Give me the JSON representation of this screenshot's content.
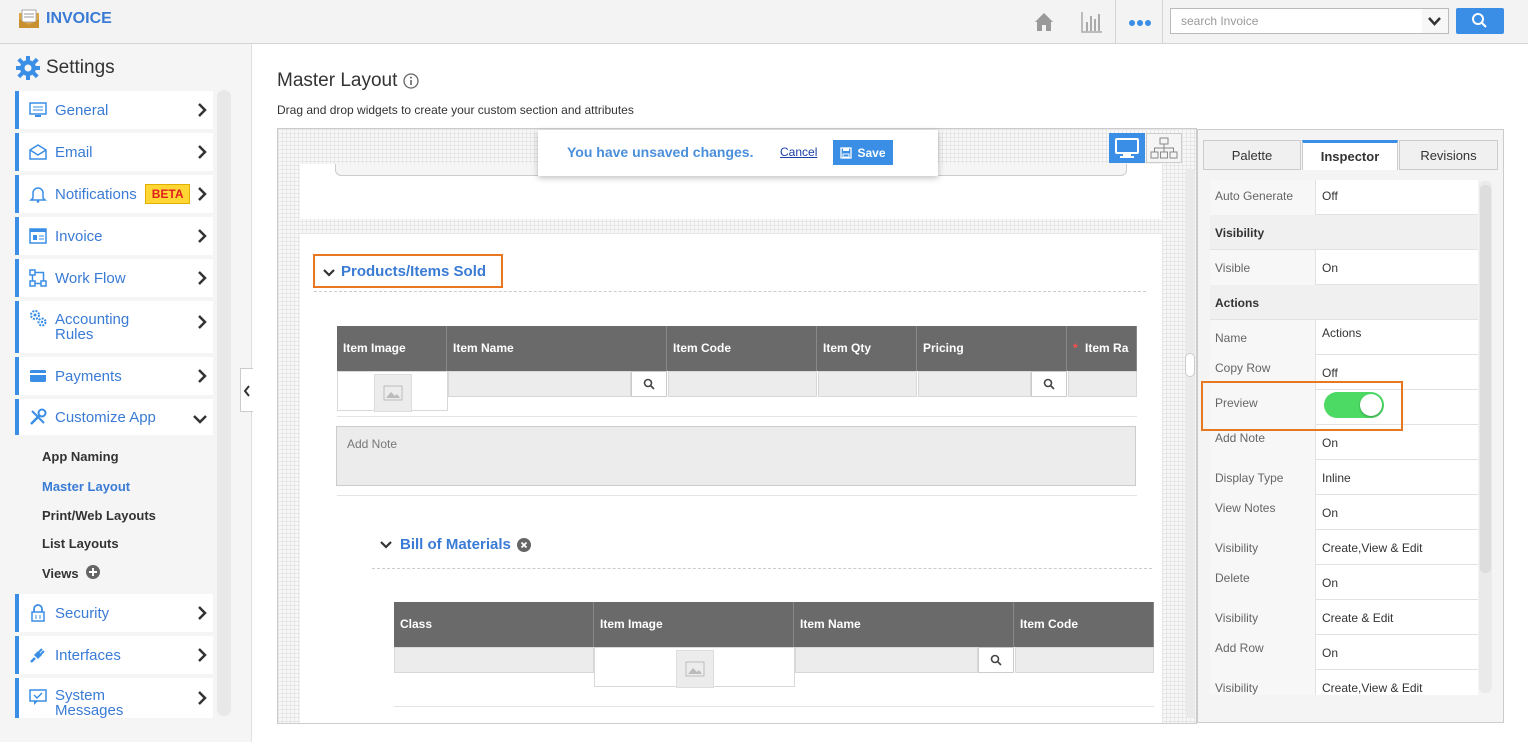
{
  "app": {
    "title": "INVOICE"
  },
  "header": {
    "search_placeholder": "search Invoice",
    "icons": [
      "home-icon",
      "chart-icon",
      "more-icon",
      "chevron-down-icon",
      "search-icon"
    ]
  },
  "sidebar": {
    "title": "Settings",
    "items": [
      {
        "label": "General",
        "icon": "monitor-icon"
      },
      {
        "label": "Email",
        "icon": "envelope-icon"
      },
      {
        "label": "Notifications",
        "icon": "bell-icon",
        "badge": "BETA"
      },
      {
        "label": "Invoice",
        "icon": "invoice-icon"
      },
      {
        "label": "Work Flow",
        "icon": "workflow-icon"
      },
      {
        "label": "Accounting Rules",
        "icon": "gears-icon"
      },
      {
        "label": "Payments",
        "icon": "card-icon"
      },
      {
        "label": "Customize App",
        "icon": "tools-icon"
      },
      {
        "label": "Security",
        "icon": "lock-icon"
      },
      {
        "label": "Interfaces",
        "icon": "plug-icon"
      },
      {
        "label": "System Messages",
        "icon": "message-icon"
      }
    ],
    "subitems": [
      {
        "label": "App Naming"
      },
      {
        "label": "Master Layout"
      },
      {
        "label": "Print/Web Layouts"
      },
      {
        "label": "List Layouts"
      },
      {
        "label": "Views"
      }
    ]
  },
  "main": {
    "title": "Master Layout",
    "subtitle": "Drag and drop widgets to create your custom section and attributes",
    "unsaved": {
      "message": "You have unsaved changes.",
      "cancel": "Cancel",
      "save": "Save"
    },
    "section_title": "Products/Items Sold",
    "table1_headers": [
      "Item Image",
      "Item Name",
      "Item Code",
      "Item Qty",
      "Pricing",
      "Item Ra"
    ],
    "required_mark": "*",
    "add_note_placeholder": "Add Note",
    "bom_title": "Bill of Materials",
    "table2_headers": [
      "Class",
      "Item Image",
      "Item Name",
      "Item Code"
    ]
  },
  "panel": {
    "tabs": [
      "Palette",
      "Inspector",
      "Revisions"
    ],
    "rows": [
      {
        "key": "Auto Generate",
        "value": "Off"
      },
      {
        "group": "Visibility"
      },
      {
        "key": "Visible",
        "value": "On"
      },
      {
        "group": "Actions"
      },
      {
        "key": "Name",
        "value": "Actions"
      },
      {
        "key": "Copy Row",
        "value": "Off"
      },
      {
        "key": "Preview",
        "value": ""
      },
      {
        "key": "Add Note",
        "value": "On"
      },
      {
        "key": "Display Type",
        "value": "Inline"
      },
      {
        "key": "View Notes",
        "value": "On"
      },
      {
        "key": "Visibility",
        "value": "Create,View & Edit"
      },
      {
        "key": "Delete",
        "value": "On"
      },
      {
        "key": "Visibility",
        "value": "Create & Edit"
      },
      {
        "key": "Add Row",
        "value": "On"
      },
      {
        "key": "Visibility",
        "value": "Create,View & Edit"
      }
    ],
    "preview_toggle_on": true
  },
  "colors": {
    "accent": "#3a8ee6",
    "link": "#3a7bd5",
    "highlight": "#e87722",
    "toggle_on": "#4cd964",
    "table_header": "#6a6a6a"
  }
}
